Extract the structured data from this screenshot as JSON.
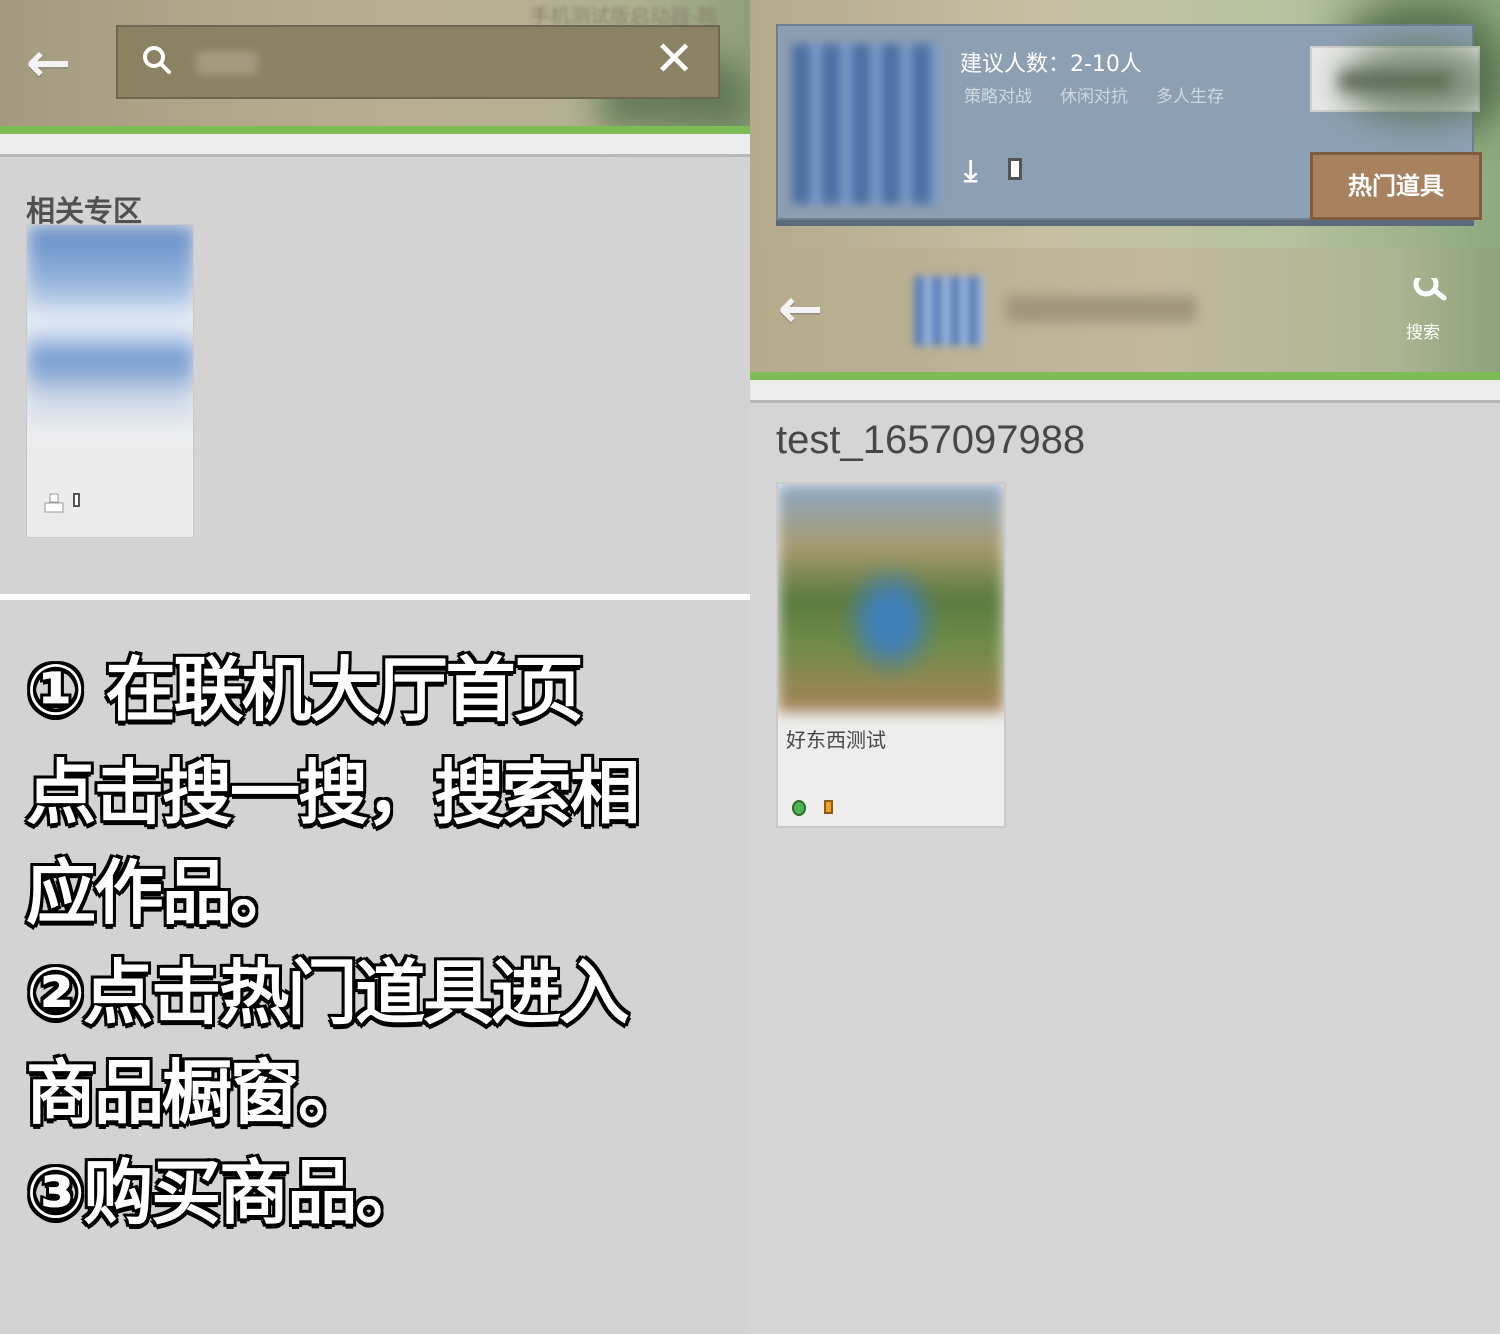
{
  "left": {
    "header": {
      "watermark_text": "手机测试版启动器-翰",
      "back_icon": "back-arrow-icon",
      "search": {
        "icon": "search-icon",
        "clear_icon": "close-icon"
      }
    },
    "related_zone": {
      "title": "相关专区"
    },
    "instructions": {
      "step1_line1": "① 在联机大厅首页",
      "step1_line2": "点击搜一搜，搜索相",
      "step1_line3": "应作品。",
      "step2_line1": "②点击热门道具进入",
      "step2_line2": "商品橱窗。",
      "step3_line1": "③购买商品。"
    }
  },
  "right": {
    "room_card": {
      "players": "建议人数：2-10人",
      "tags": [
        "策略对战",
        "休闲对抗",
        "多人生存"
      ],
      "hot_items_button": "热门道具"
    },
    "shop_header": {
      "back_icon": "back-arrow-icon",
      "search_label": "搜索"
    },
    "shop_name": "test_1657097988",
    "items": [
      {
        "name": "好东西测试",
        "currency_icon": "emerald-icon"
      }
    ]
  },
  "colors": {
    "green_accent": "#7ebd55",
    "hot_button": "#a8825e",
    "card_blue": "#8d9fb2"
  }
}
